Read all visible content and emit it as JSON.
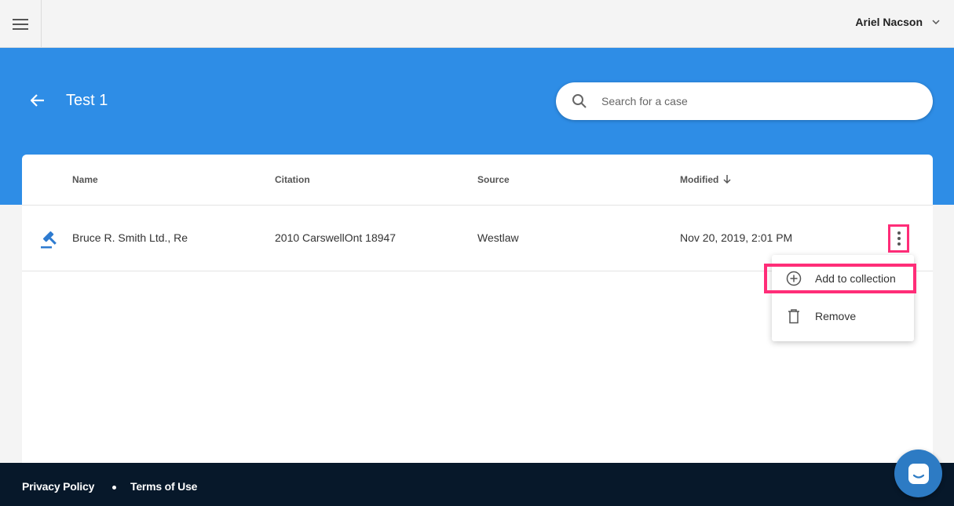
{
  "user": {
    "name": "Ariel Nacson"
  },
  "header": {
    "title": "Test 1"
  },
  "search": {
    "placeholder": "Search for a case",
    "value": ""
  },
  "table": {
    "columns": [
      "Name",
      "Citation",
      "Source",
      "Modified"
    ],
    "rows": [
      {
        "name": "Bruce R. Smith Ltd., Re",
        "citation": "2010 CarswellOnt 18947",
        "source": "Westlaw",
        "modified": "Nov 20, 2019, 2:01 PM"
      }
    ]
  },
  "menu": {
    "items": [
      {
        "label": "Add to collection",
        "icon": "add-circle-icon"
      },
      {
        "label": "Remove",
        "icon": "trash-icon"
      }
    ]
  },
  "footer": {
    "privacy": "Privacy Policy",
    "terms": "Terms of Use"
  },
  "colors": {
    "primary": "#2e8de6",
    "highlight": "#ff2d78",
    "footer": "#07182a",
    "gavel": "#2e7bd0"
  }
}
